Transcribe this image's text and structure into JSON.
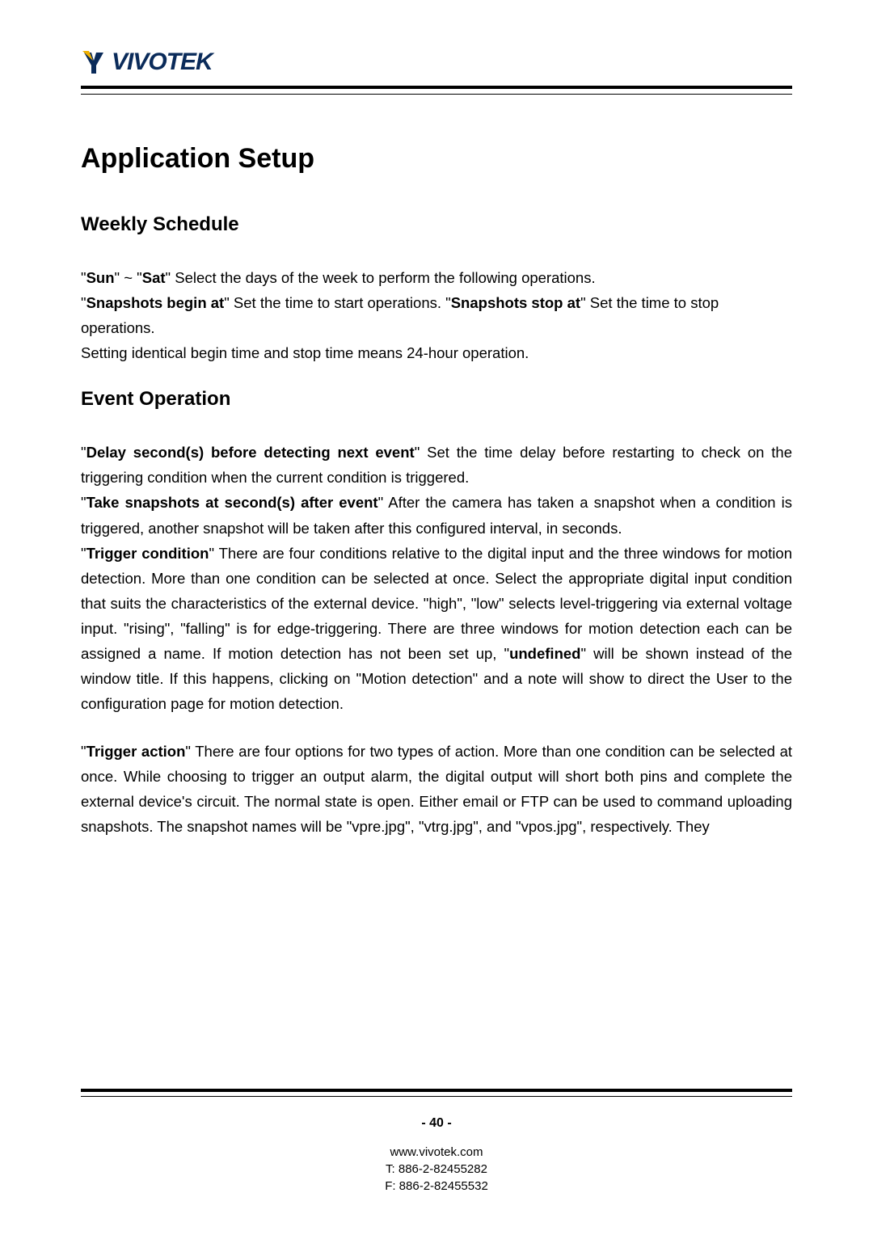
{
  "logo": {
    "brand": "VIVOTEK"
  },
  "title": "Application Setup",
  "sections": {
    "weekly": {
      "heading": "Weekly Schedule",
      "p1_pre": "\"",
      "p1_sun": "Sun",
      "p1_mid1": "\" ~ \"",
      "p1_sat": "Sat",
      "p1_post1": "\" Select the days of the week to perform the following operations.",
      "p2_pre": "\"",
      "p2_begin": "Snapshots begin at",
      "p2_mid": "\" Set the time to start operations. \"",
      "p2_stop": "Snapshots stop at",
      "p2_post": "\" Set the time to stop operations.",
      "p3": "Setting identical begin time and stop time means 24-hour operation."
    },
    "event": {
      "heading": "Event Operation",
      "d1_pre": "\"",
      "d1_key": "Delay second(s) before detecting next event",
      "d1_post": "\" Set the time delay before restarting to check on the triggering condition when the current condition is triggered.",
      "d2_pre": "\"",
      "d2_key": "Take snapshots at second(s) after event",
      "d2_post": "\" After the camera has taken a snapshot when a condition is triggered, another snapshot will be taken after this configured interval, in seconds.",
      "d3_pre": "\"",
      "d3_key": "Trigger condition",
      "d3_mid": "\" There are four conditions relative to the digital input and the three windows for motion detection. More than one condition can be selected at once. Select the appropriate digital input condition that suits the characteristics of the external device. \"high\", \"low\" selects level-triggering via  external voltage input. \"rising\", \"falling\" is for edge-triggering. There are three windows for motion detection each can be assigned a name. If motion detection has not been set up, \"",
      "d3_undef": "undefined",
      "d3_post": "\" will be shown instead of the window title. If this happens, clicking on \"Motion detection\" and a note will show to direct the User to the configuration page for motion detection.",
      "d4_pre": "\"",
      "d4_key": "Trigger action",
      "d4_post": "\" There are four options for two types of action. More than one condition can be selected at once. While choosing to trigger an output alarm, the digital output will short both pins and complete the external device's circuit.  The normal state is open. Either email or FTP can be used to command uploading snapshots. The snapshot names will be \"vpre.jpg\", \"vtrg.jpg\", and \"vpos.jpg\", respectively.  They"
    }
  },
  "footer": {
    "page": "- 40 -",
    "url": "www.vivotek.com",
    "tel": "T: 886-2-82455282",
    "fax": "F: 886-2-82455532"
  }
}
